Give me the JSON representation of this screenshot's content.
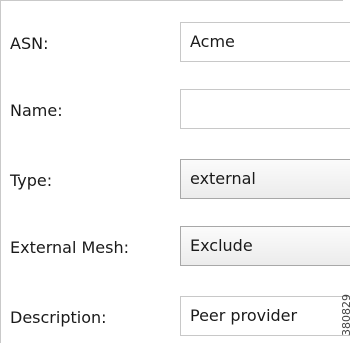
{
  "form": {
    "asn": {
      "label": "ASN:",
      "value": "Acme"
    },
    "name": {
      "label": "Name:",
      "value": ""
    },
    "type": {
      "label": "Type:",
      "value": "external"
    },
    "external_mesh": {
      "label": "External Mesh:",
      "value": "Exclude"
    },
    "description": {
      "label": "Description:",
      "value": "Peer provider"
    }
  },
  "figure_id": "380829"
}
